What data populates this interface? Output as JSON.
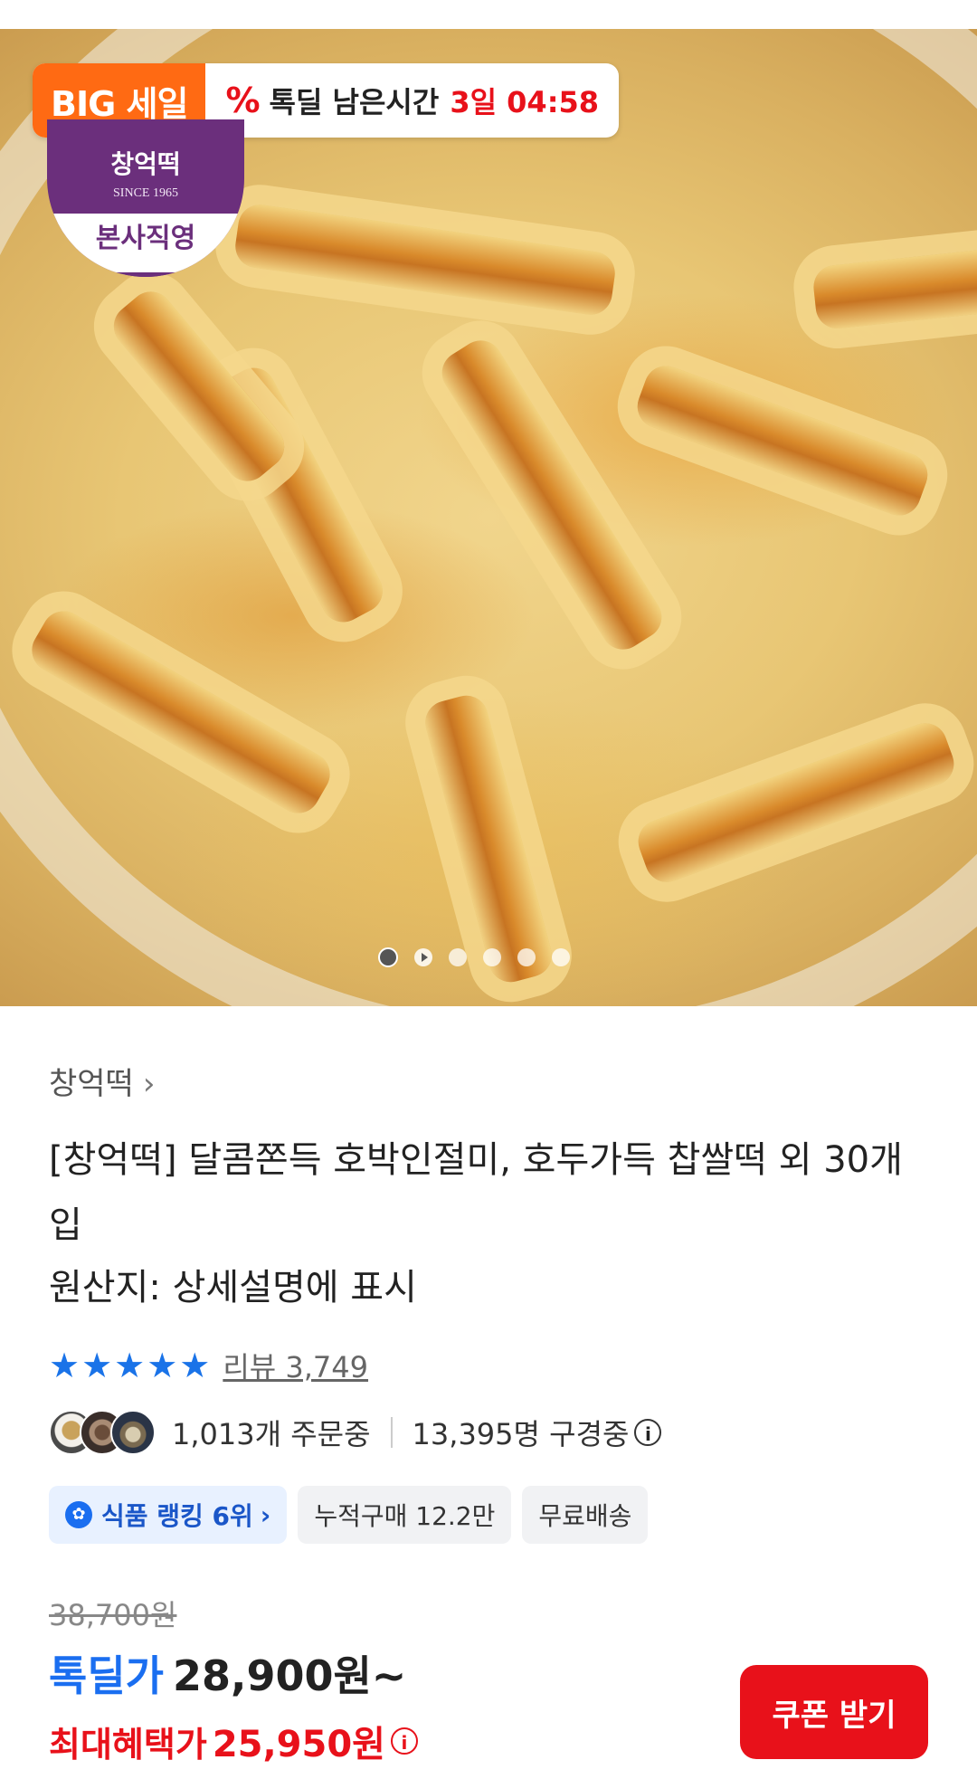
{
  "promo": {
    "badge_label": "BIG 세일",
    "timer_label": "톡딜 남은시간",
    "timer_value": "3일 04:58"
  },
  "store_logo": {
    "brand": "창억떡",
    "since": "SINCE 1965",
    "tag": "본사직영"
  },
  "carousel": {
    "dots": [
      "image",
      "video",
      "image",
      "image",
      "image",
      "image"
    ],
    "active_index": 0
  },
  "product": {
    "brand_link": "창억떡",
    "title": "[창억떡] 달콤쫀득 호박인절미, 호두가득 찹쌀떡 외 30개입",
    "origin": "원산지: 상세설명에 표시",
    "rating_stars": "★★★★★",
    "review_label": "리뷰 3,749",
    "orders": "1,013개 주문중",
    "viewers": "13,395명 구경중",
    "chips": {
      "ranking": "식품 랭킹 6위",
      "cumulative": "누적구매 12.2만",
      "shipping": "무료배송"
    }
  },
  "price": {
    "original": "38,700원",
    "deal_label": "톡딜가",
    "deal_price": "28,900원~",
    "max_label": "최대혜택가",
    "max_price": "25,950원"
  },
  "coupon_button": "쿠폰 받기",
  "colors": {
    "sale_orange": "#ff6a13",
    "accent_red": "#e8111a",
    "accent_blue": "#1a6ef0",
    "logo_purple": "#6b2f7c"
  }
}
